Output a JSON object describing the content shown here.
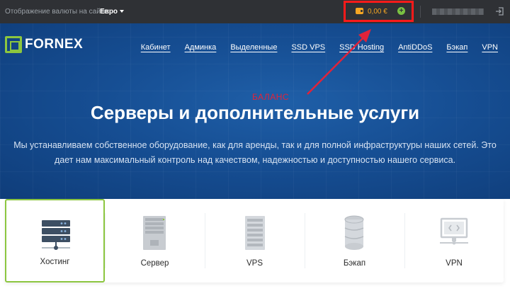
{
  "topbar": {
    "currency_label": "Отображение валюты на сайте:",
    "currency_value": "Евро",
    "balance": "0,00 €",
    "add_symbol": "+"
  },
  "hero": {
    "logo_text": "FORNEX",
    "nav": [
      "Кабинет",
      "Админка",
      "Выделенные",
      "SSD VPS",
      "SSD Hosting",
      "AntiDDoS",
      "Бэкап",
      "VPN"
    ],
    "annotation": "БАЛАНС",
    "title": "Серверы и дополнительные услуги",
    "description_line1": "Мы устанавливаем собственное оборудование, как для аренды, так и для полной инфраструктуры наших сетей. Это",
    "description_line2": "дает нам максимальный контроль над качеством, надежностью и доступностью нашего сервиса."
  },
  "services": [
    {
      "label": "Хостинг",
      "icon": "hosting-rack-icon",
      "active": true
    },
    {
      "label": "Сервер",
      "icon": "server-tower-icon",
      "active": false
    },
    {
      "label": "VPS",
      "icon": "vps-rack-icon",
      "active": false
    },
    {
      "label": "Бэкап",
      "icon": "backup-database-icon",
      "active": false
    },
    {
      "label": "VPN",
      "icon": "vpn-monitor-icon",
      "active": false
    }
  ],
  "colors": {
    "accent_green": "#8cc63f",
    "balance_orange": "#f5a623",
    "highlight_red": "#ff1a1a",
    "hero_blue": "#164e93"
  }
}
